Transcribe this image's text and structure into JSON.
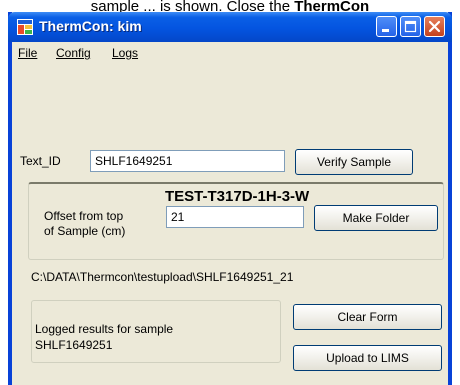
{
  "caption": {
    "text_start": "sample ... is shown. Close the ",
    "text_bold": "ThermCon"
  },
  "window": {
    "title": "ThermCon: kim"
  },
  "menu": {
    "items": [
      "File",
      "Config",
      "Logs"
    ]
  },
  "form": {
    "text_id_label": "Text_ID",
    "text_id_value": "SHLF1649251",
    "verify_button": "Verify Sample",
    "sample_name": "TEST-T317D-1H-3-W",
    "offset_label_line1": "Offset from top",
    "offset_label_line2": "of Sample (cm)",
    "offset_value": "21",
    "make_folder_button": "Make Folder",
    "folder_path": "C:\\DATA\\Thermcon\\testupload\\SHLF1649251_21",
    "results_line1": "Logged results for sample",
    "results_line2": "SHLF1649251",
    "clear_button": "Clear Form",
    "upload_button": "Upload to LIMS"
  },
  "colors": {
    "titlebar": "#0454e0",
    "window_bg": "#ece9d8",
    "close_button": "#c4421e"
  }
}
